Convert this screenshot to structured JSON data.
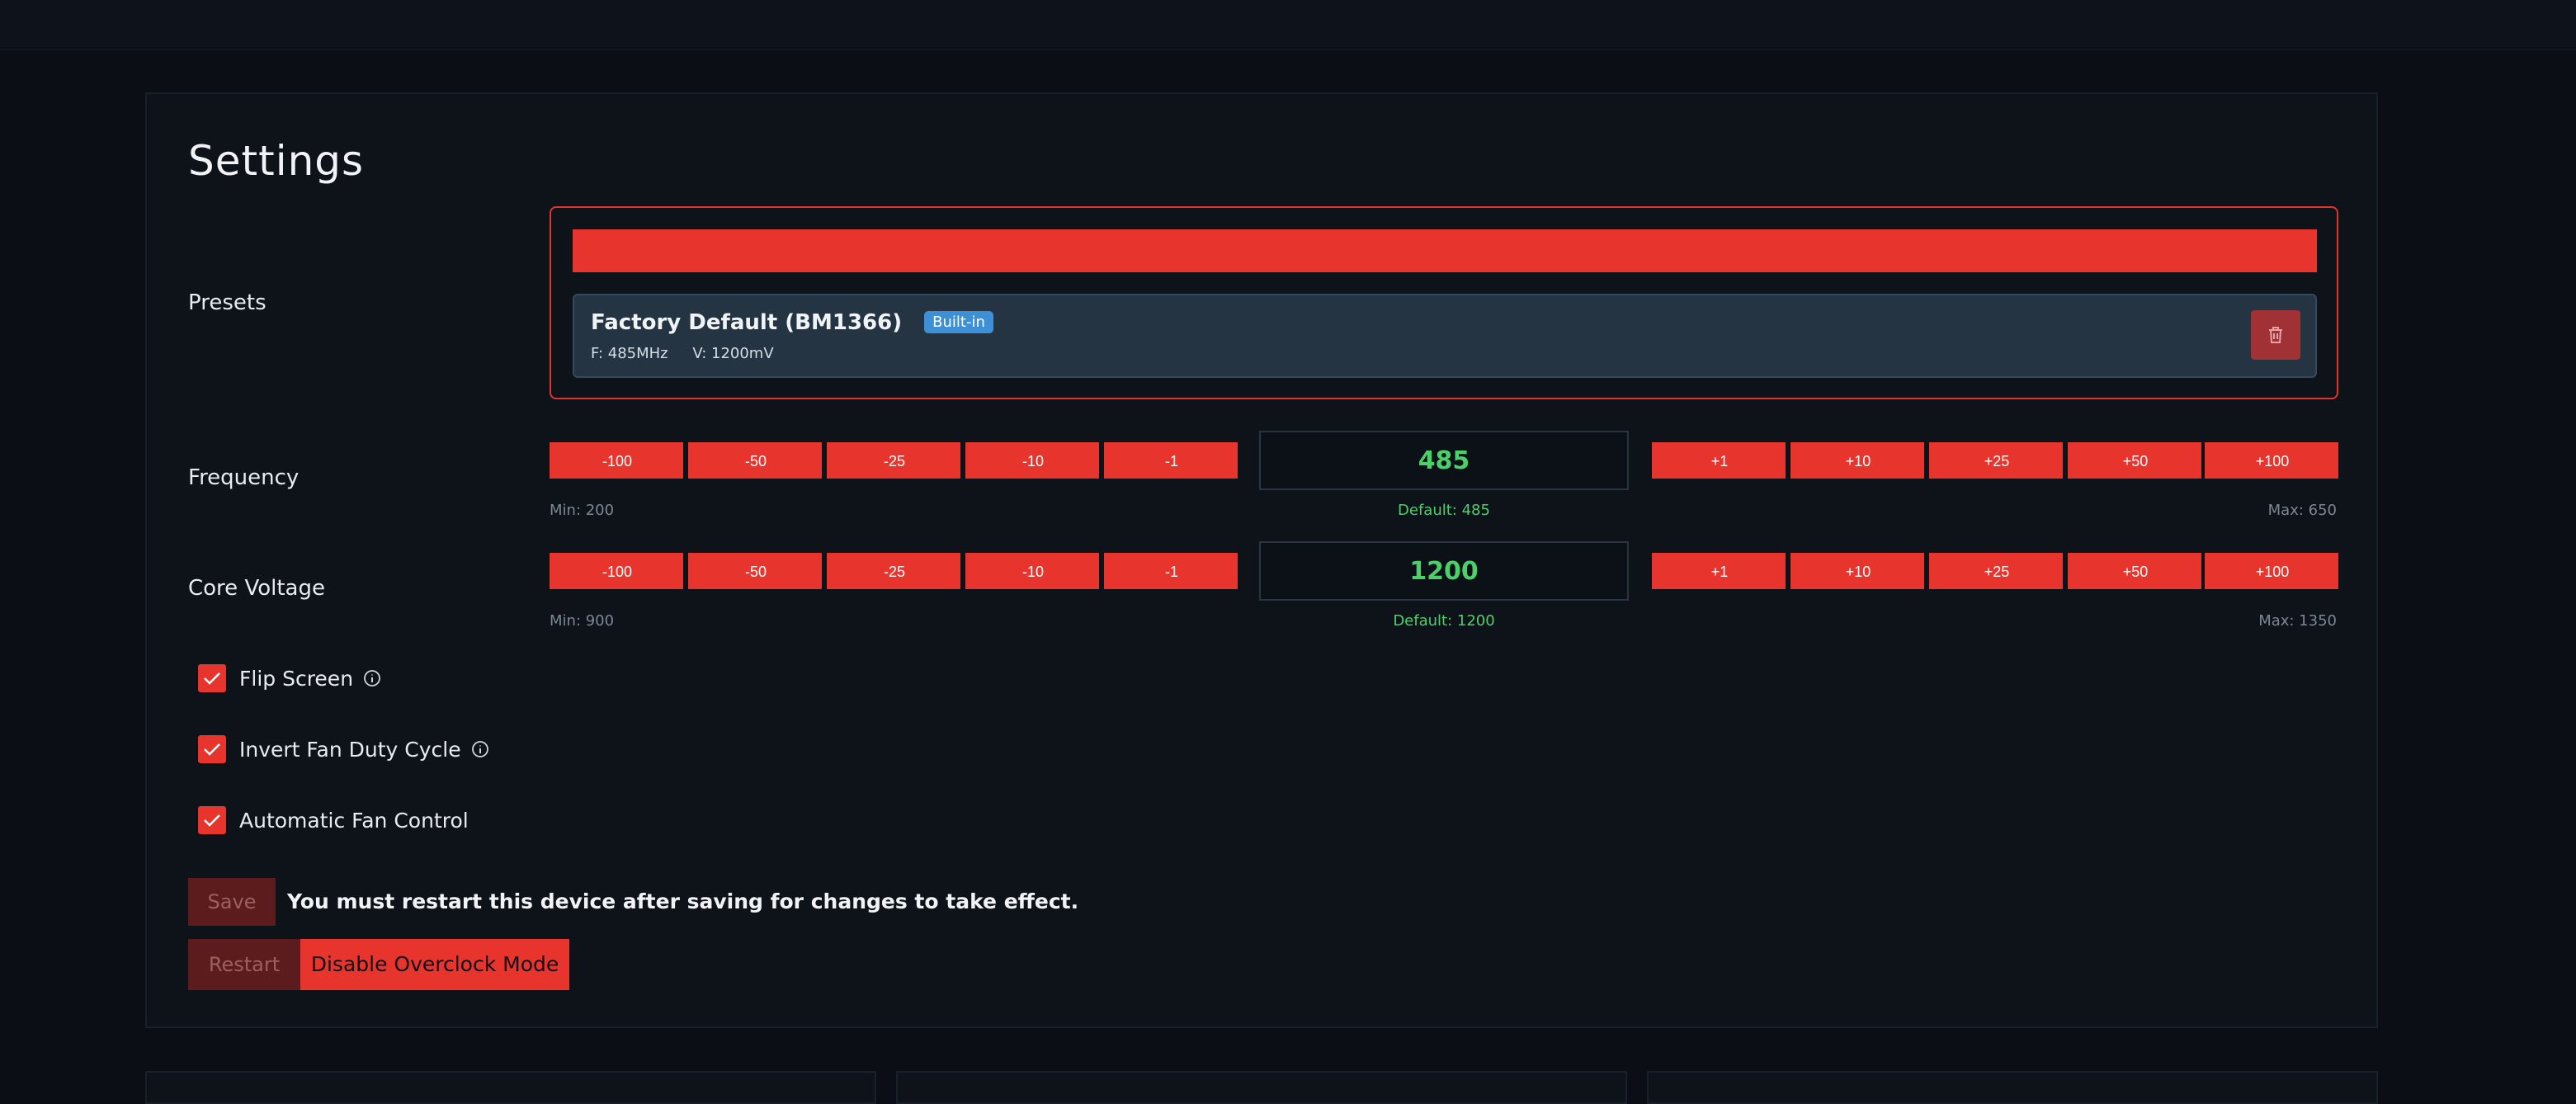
{
  "page": {
    "title": "Settings"
  },
  "presets": {
    "label": "Presets",
    "items": [
      {
        "name": "Factory Default (BM1366)",
        "badge": "Built-in",
        "frequency": "F: 485MHz",
        "voltage": "V: 1200mV"
      }
    ]
  },
  "frequency": {
    "label": "Frequency",
    "decrements": [
      "-100",
      "-50",
      "-25",
      "-10",
      "-1"
    ],
    "increments": [
      "+1",
      "+10",
      "+25",
      "+50",
      "+100"
    ],
    "value": "485",
    "min": "Min: 200",
    "default": "Default: 485",
    "max": "Max: 650"
  },
  "core_voltage": {
    "label": "Core Voltage",
    "decrements": [
      "-100",
      "-50",
      "-25",
      "-10",
      "-1"
    ],
    "increments": [
      "+1",
      "+10",
      "+25",
      "+50",
      "+100"
    ],
    "value": "1200",
    "min": "Min: 900",
    "default": "Default: 1200",
    "max": "Max: 1350"
  },
  "options": [
    {
      "label": "Flip Screen",
      "checked": true,
      "info": true
    },
    {
      "label": "Invert Fan Duty Cycle",
      "checked": true,
      "info": true
    },
    {
      "label": "Automatic Fan Control",
      "checked": true,
      "info": false
    }
  ],
  "actions": {
    "save": "Save",
    "notice": "You must restart this device after saving for changes to take effect.",
    "restart": "Restart",
    "disable_overclock": "Disable Overclock Mode"
  },
  "colors": {
    "accent": "#e7352d",
    "value_green": "#4bd06a",
    "badge_blue": "#3d8fd6",
    "background": "#0b0f15"
  }
}
